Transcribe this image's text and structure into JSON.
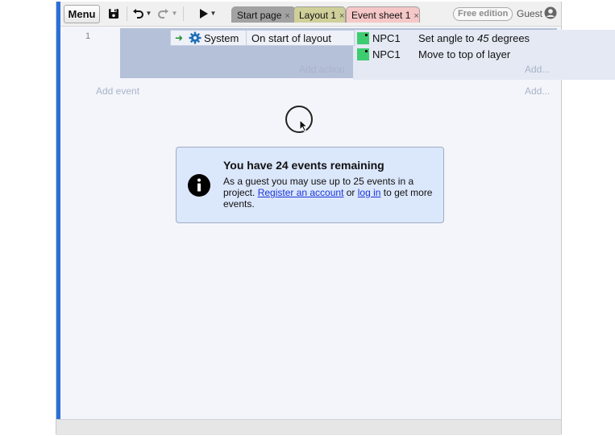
{
  "toolbar": {
    "menu_label": "Menu",
    "tabs": [
      {
        "label": "Start page",
        "close": "×"
      },
      {
        "label": "Layout 1",
        "close": "×"
      },
      {
        "label": "Event sheet 1",
        "close": "×"
      }
    ],
    "free_edition_label": "Free edition",
    "guest_label": "Guest"
  },
  "event_sheet": {
    "events": [
      {
        "number": "1",
        "condition": {
          "object": "System",
          "text": "On start of layout"
        },
        "actions": [
          {
            "object": "NPC1",
            "text_before": "Set angle to ",
            "text_value": "45",
            "text_after": " degrees"
          },
          {
            "object": "NPC1",
            "text": "Move to top of layer"
          }
        ]
      }
    ],
    "add_action_label": "Add action",
    "add_dots_label": "Add...",
    "add_event_label": "Add event"
  },
  "notice": {
    "title": "You have 24 events remaining",
    "body_start": "As a guest you may use up to 25 events in a project. ",
    "register_link": "Register an account",
    "or_text": " or ",
    "login_link": "log in",
    "body_end": " to get more events."
  },
  "colors": {
    "accent_blue": "#2d6fd9",
    "event_block": "#b5c1d8",
    "sprite_green": "#3ecc70",
    "notice_bg": "#dbe7fb",
    "link": "#1a35d9"
  },
  "icons": {
    "save": "floppy-disk-icon",
    "undo": "undo-icon",
    "redo": "redo-icon",
    "play": "play-icon",
    "user": "user-circle-icon",
    "system": "gear-icon",
    "info": "info-circle-icon"
  }
}
